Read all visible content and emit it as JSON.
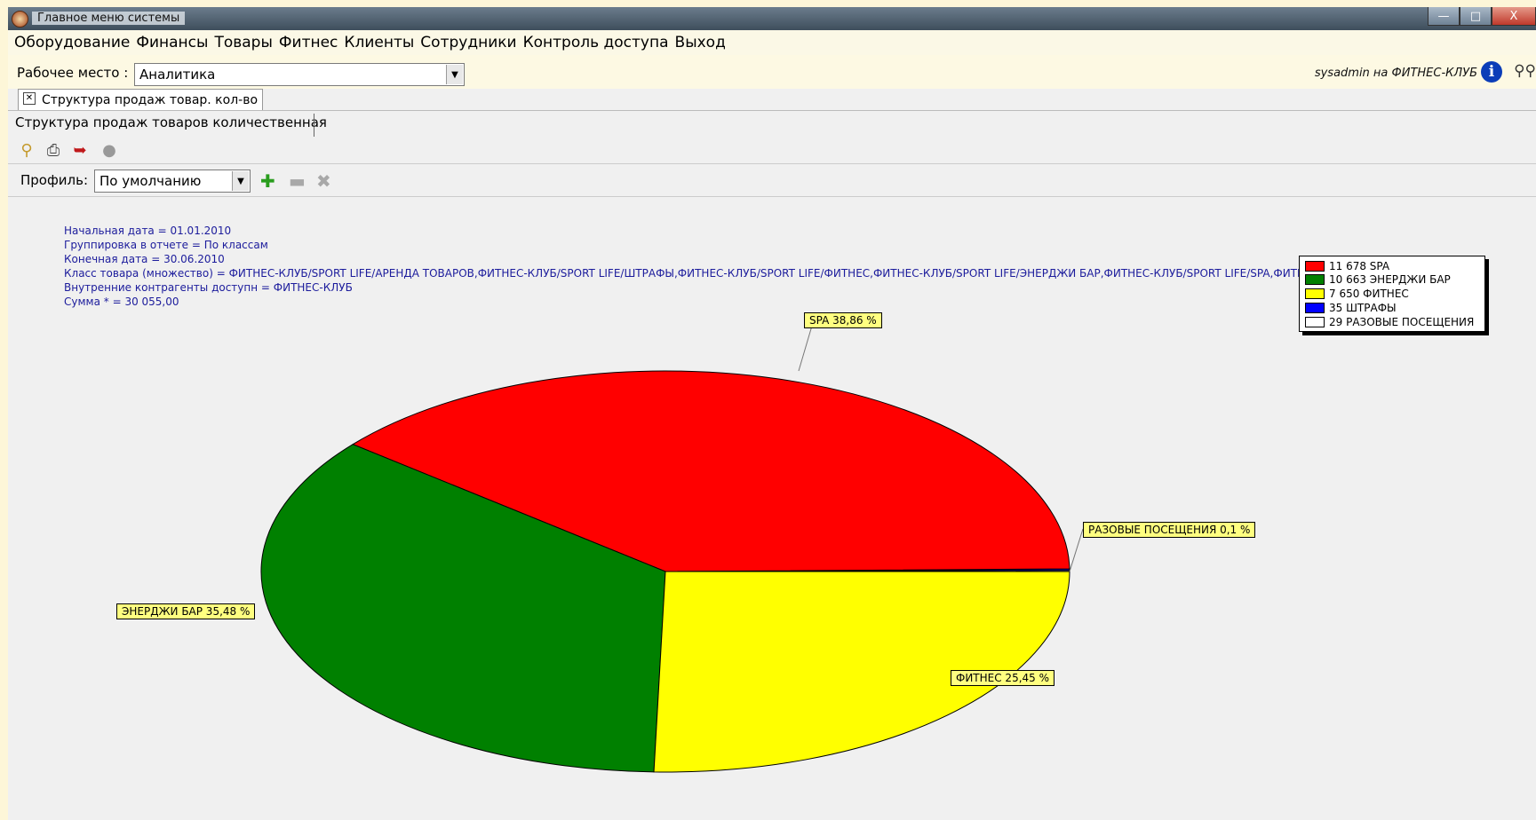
{
  "window": {
    "title": "Главное меню системы",
    "minimize": "—",
    "maximize": "□",
    "close": "X"
  },
  "menu": [
    "Оборудование",
    "Финансы",
    "Товары",
    "Фитнес",
    "Клиенты",
    "Сотрудники",
    "Контроль доступа",
    "Выход"
  ],
  "workspace": {
    "label": "Рабочее место :",
    "value": "Аналитика",
    "user": "sysadmin на ФИТНЕС-КЛУБ"
  },
  "doc_tab": {
    "close": "✕",
    "title": "Структура продаж товар. кол-во"
  },
  "report_tab": "Структура продаж товаров количественная",
  "profile": {
    "label": "Профиль:",
    "value": "По умолчанию"
  },
  "params": [
    "Начальная дата = 01.01.2010",
    "Группировка в отчете = По классам",
    "Конечная дата = 30.06.2010",
    "Класс товара (множество) = ФИТНЕС-КЛУБ/SPORT LIFE/АРЕНДА ТОВАРОВ,ФИТНЕС-КЛУБ/SPORT LIFE/ШТРАФЫ,ФИТНЕС-КЛУБ/SPORT LIFE/ФИТНЕС,ФИТНЕС-КЛУБ/SPORT LIFE/ЭНЕРДЖИ БАР,ФИТНЕС-КЛУБ/SPORT LIFE/SPA,ФИТНЕС-КЛУБ/SPORT LIFE/РАЗОВ",
    "Внутренние контрагенты доступн = ФИТНЕС-КЛУБ",
    "Сумма * = 30 055,00"
  ],
  "chart_data": {
    "type": "pie",
    "slices": [
      {
        "name": "SPA",
        "value": 11678,
        "legend": "11 678 SPA",
        "label": "SPA 38,86 %",
        "color": "#ff0000"
      },
      {
        "name": "ЭНЕРДЖИ БАР",
        "value": 10663,
        "legend": "10 663 ЭНЕРДЖИ БАР",
        "label": "ЭНЕРДЖИ БАР 35,48 %",
        "color": "#008000"
      },
      {
        "name": "ФИТНЕС",
        "value": 7650,
        "legend": "7 650 ФИТНЕС",
        "label": "ФИТНЕС 25,45 %",
        "color": "#ffff00"
      },
      {
        "name": "ШТРАФЫ",
        "value": 35,
        "legend": "35 ШТРАФЫ",
        "label": "",
        "color": "#0000ff"
      },
      {
        "name": "РАЗОВЫЕ ПОСЕЩЕНИЯ",
        "value": 29,
        "legend": "29 РАЗОВЫЕ ПОСЕЩЕНИЯ",
        "label": "РАЗОВЫЕ ПОСЕЩЕНИЯ 0,1 %",
        "color": "#ffffff"
      }
    ],
    "legend_position": "top-right"
  }
}
